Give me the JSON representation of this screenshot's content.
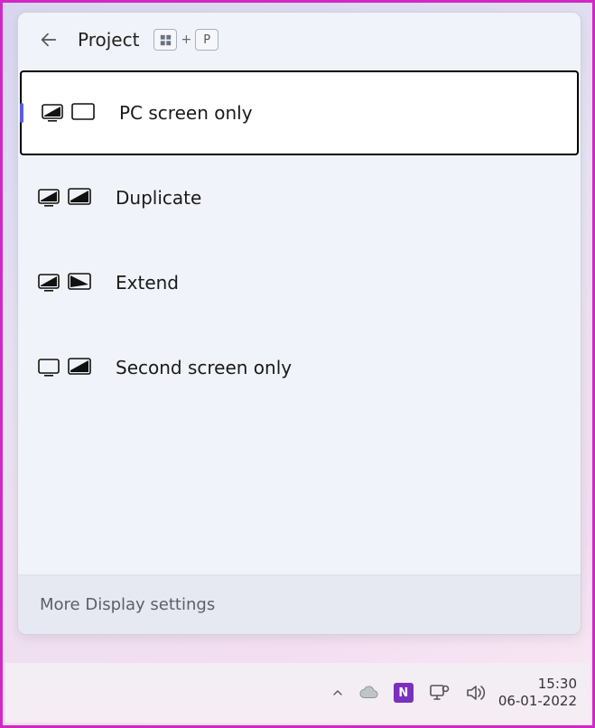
{
  "panel": {
    "title": "Project",
    "shortcut_key2": "P",
    "footer_link": "More Display settings"
  },
  "options": [
    {
      "label": "PC screen only",
      "selected": true
    },
    {
      "label": "Duplicate",
      "selected": false
    },
    {
      "label": "Extend",
      "selected": false
    },
    {
      "label": "Second screen only",
      "selected": false
    }
  ],
  "taskbar": {
    "time": "15:30",
    "date": "06-01-2022",
    "onenote_badge": "N"
  }
}
